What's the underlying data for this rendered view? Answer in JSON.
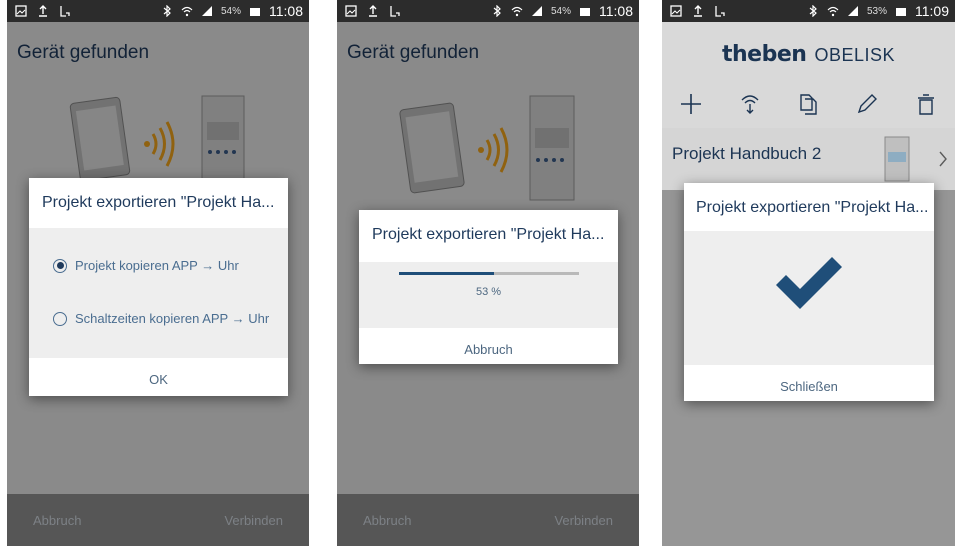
{
  "status_bar": [
    {
      "battery": "54%",
      "time": "11:08"
    },
    {
      "battery": "54%",
      "time": "11:08"
    },
    {
      "battery": "53%",
      "time": "11:09"
    }
  ],
  "screen1": {
    "app_title": "Gerät gefunden",
    "dialog": {
      "title": "Projekt exportieren \"Projekt Ha...",
      "options": [
        {
          "label": "Projekt kopieren APP → Uhr",
          "selected": true
        },
        {
          "label": "Schaltzeiten kopieren APP → Uhr",
          "selected": false
        }
      ],
      "ok_label": "OK"
    },
    "bottom_bar": {
      "cancel_label": "Abbruch",
      "connect_label": "Verbinden"
    }
  },
  "screen2": {
    "app_title": "Gerät gefunden",
    "dialog": {
      "title": "Projekt exportieren \"Projekt Ha...",
      "progress": 0.53,
      "progress_label": "53 %",
      "cancel_label": "Abbruch"
    },
    "bottom_bar": {
      "cancel_label": "Abbruch",
      "connect_label": "Verbinden"
    }
  },
  "screen3": {
    "logo_brand": "theben",
    "logo_product": "OBELISK",
    "toolbar_icons": [
      "add-icon",
      "transfer-icon",
      "copy-icon",
      "edit-icon",
      "delete-icon"
    ],
    "project_name": "Projekt Handbuch 2",
    "dialog": {
      "title": "Projekt exportieren \"Projekt Ha...",
      "close_label": "Schließen"
    }
  },
  "colors": {
    "primary": "#1f3a5c",
    "progress": "#1f4e79",
    "checkmark": "#1f4e79",
    "wave": "#f0a31c"
  }
}
